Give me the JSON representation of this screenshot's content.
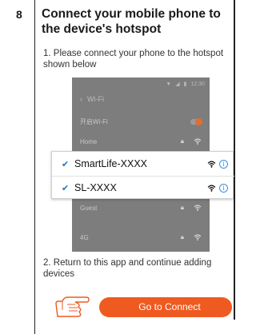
{
  "step": {
    "number": "8"
  },
  "heading": "Connect your mobile phone to the device's hotspot",
  "instructions": {
    "step1": "1. Please connect your phone to the hotspot shown below",
    "step2": "2. Return to this app and continue adding devices"
  },
  "phone": {
    "status_time": "12:30",
    "back_label": "Wi-Fi",
    "wifi_toggle_label": "开启Wi-Fi",
    "networks": [
      "Home",
      "Guest",
      "4G"
    ]
  },
  "hotspots": [
    {
      "name": "SmartLife-XXXX"
    },
    {
      "name": "SL-XXXX"
    }
  ],
  "button": {
    "label": "Go to Connect"
  },
  "colors": {
    "accent": "#ef5a20",
    "check_blue": "#1e73c8",
    "toggle_orange": "#e66d2c"
  }
}
